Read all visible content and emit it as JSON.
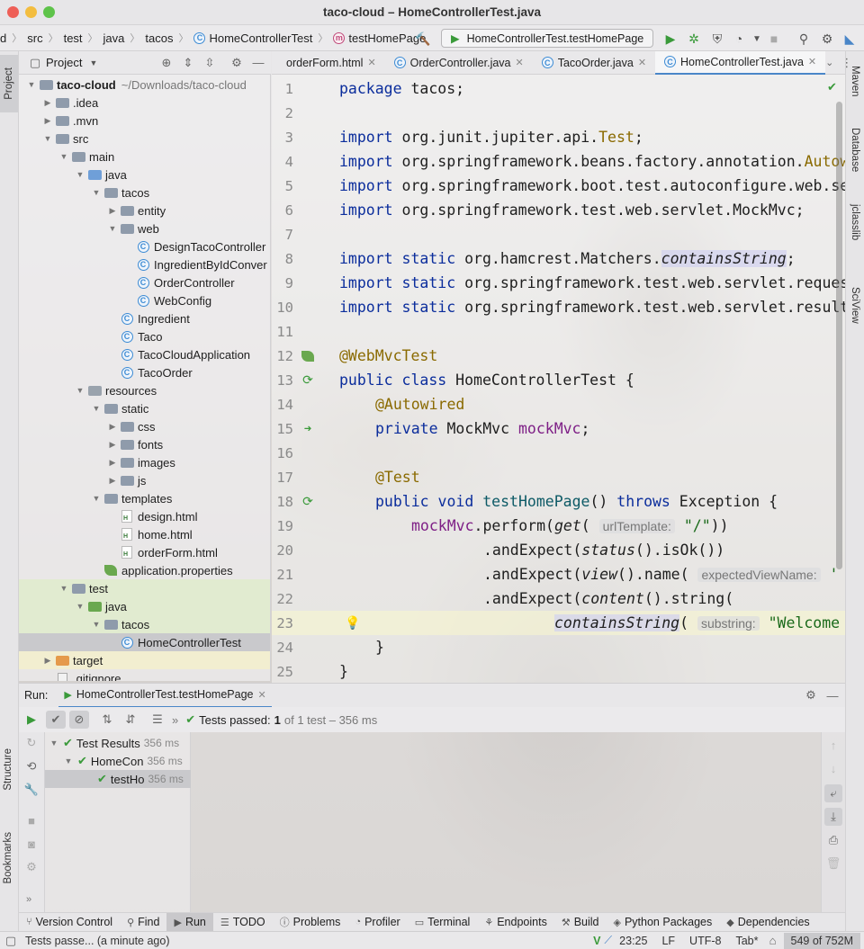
{
  "window": {
    "title": "taco-cloud – HomeControllerTest.java"
  },
  "navbar": {
    "breadcrumbs": [
      "d",
      "src",
      "test",
      "java",
      "tacos",
      "HomeControllerTest",
      "testHomePage"
    ],
    "run_config": "HomeControllerTest.testHomePage"
  },
  "left_stripe": {
    "project_label": "Project",
    "structure_label": "Structure",
    "bookmarks_label": "Bookmarks"
  },
  "right_stripe": {
    "items": [
      "Maven",
      "Database",
      "jclasslib",
      "SciView"
    ]
  },
  "project_panel": {
    "title": "Project",
    "tree": [
      {
        "label": "taco-cloud",
        "extra": "~/Downloads/taco-cloud",
        "depth": 0,
        "arrow": "down",
        "icon": "folder"
      },
      {
        "label": ".idea",
        "depth": 1,
        "arrow": "right",
        "icon": "folder"
      },
      {
        "label": ".mvn",
        "depth": 1,
        "arrow": "right",
        "icon": "folder"
      },
      {
        "label": "src",
        "depth": 1,
        "arrow": "down",
        "icon": "folder"
      },
      {
        "label": "main",
        "depth": 2,
        "arrow": "down",
        "icon": "folder"
      },
      {
        "label": "java",
        "depth": 3,
        "arrow": "down",
        "icon": "src"
      },
      {
        "label": "tacos",
        "depth": 4,
        "arrow": "down",
        "icon": "folder"
      },
      {
        "label": "entity",
        "depth": 5,
        "arrow": "right",
        "icon": "folder"
      },
      {
        "label": "web",
        "depth": 5,
        "arrow": "down",
        "icon": "folder"
      },
      {
        "label": "DesignTacoController",
        "depth": 6,
        "arrow": "",
        "icon": "class"
      },
      {
        "label": "IngredientByIdConver",
        "depth": 6,
        "arrow": "",
        "icon": "class"
      },
      {
        "label": "OrderController",
        "depth": 6,
        "arrow": "",
        "icon": "class"
      },
      {
        "label": "WebConfig",
        "depth": 6,
        "arrow": "",
        "icon": "class"
      },
      {
        "label": "Ingredient",
        "depth": 5,
        "arrow": "",
        "icon": "class"
      },
      {
        "label": "Taco",
        "depth": 5,
        "arrow": "",
        "icon": "class"
      },
      {
        "label": "TacoCloudApplication",
        "depth": 5,
        "arrow": "",
        "icon": "class"
      },
      {
        "label": "TacoOrder",
        "depth": 5,
        "arrow": "",
        "icon": "class"
      },
      {
        "label": "resources",
        "depth": 3,
        "arrow": "down",
        "icon": "res"
      },
      {
        "label": "static",
        "depth": 4,
        "arrow": "down",
        "icon": "folder"
      },
      {
        "label": "css",
        "depth": 5,
        "arrow": "right",
        "icon": "folder"
      },
      {
        "label": "fonts",
        "depth": 5,
        "arrow": "right",
        "icon": "folder"
      },
      {
        "label": "images",
        "depth": 5,
        "arrow": "right",
        "icon": "folder"
      },
      {
        "label": "js",
        "depth": 5,
        "arrow": "right",
        "icon": "folder"
      },
      {
        "label": "templates",
        "depth": 4,
        "arrow": "down",
        "icon": "folder"
      },
      {
        "label": "design.html",
        "depth": 5,
        "arrow": "",
        "icon": "html"
      },
      {
        "label": "home.html",
        "depth": 5,
        "arrow": "",
        "icon": "html"
      },
      {
        "label": "orderForm.html",
        "depth": 5,
        "arrow": "",
        "icon": "html"
      },
      {
        "label": "application.properties",
        "depth": 4,
        "arrow": "",
        "icon": "leaf"
      },
      {
        "label": "test",
        "depth": 2,
        "arrow": "down",
        "icon": "folder"
      },
      {
        "label": "java",
        "depth": 3,
        "arrow": "down",
        "icon": "test"
      },
      {
        "label": "tacos",
        "depth": 4,
        "arrow": "down",
        "icon": "folder"
      },
      {
        "label": "HomeControllerTest",
        "depth": 5,
        "arrow": "",
        "icon": "class"
      },
      {
        "label": "target",
        "depth": 1,
        "arrow": "right",
        "icon": "orange"
      },
      {
        "label": ".gitignore",
        "depth": 1,
        "arrow": "",
        "icon": "file"
      }
    ]
  },
  "editor": {
    "tabs": [
      {
        "label": "orderForm.html",
        "icon": "html",
        "active": false
      },
      {
        "label": "OrderController.java",
        "icon": "class",
        "active": false
      },
      {
        "label": "TacoOrder.java",
        "icon": "class",
        "active": false
      },
      {
        "label": "HomeControllerTest.java",
        "icon": "class",
        "active": true
      }
    ],
    "line_numbers": [
      "1",
      "2",
      "3",
      "4",
      "5",
      "6",
      "7",
      "8",
      "9",
      "10",
      "11",
      "12",
      "13",
      "14",
      "15",
      "16",
      "17",
      "18",
      "19",
      "20",
      "21",
      "22",
      "23",
      "24",
      "25"
    ],
    "code": {
      "l1_kw": "package",
      "l1_rest": " tacos;",
      "imp": "import",
      "imp_static": "static",
      "l3": " org.junit.jupiter.api.",
      "l3_b": "Test",
      "l3_c": ";",
      "l4": " org.springframework.beans.factory.annotation.",
      "l4_b": "Autow",
      "l5": " org.springframework.boot.test.autoconfigure.web.se",
      "l6": " org.springframework.test.web.servlet.MockMvc;",
      "l8": " org.hamcrest.Matchers.",
      "l8_b": "containsString",
      "l8_c": ";",
      "l9": " org.springframework.test.web.servlet.reques",
      "l10": " org.springframework.test.web.servlet.result",
      "l12": "@WebMvcTest",
      "l13_kw1": "public",
      "l13_kw2": "class",
      "l13_rest": " HomeControllerTest {",
      "l14": "@Autowired",
      "l15_kw": "private",
      "l15_type": " MockMvc ",
      "l15_fld": "mockMvc",
      "l15_c": ";",
      "l17": "@Test",
      "l18_kw1": "public",
      "l18_kw2": "void",
      "l18_fn": "testHomePage",
      "l18_p": "() ",
      "l18_kw3": "throws",
      "l18_rest": " Exception {",
      "l19_fld": "mockMvc",
      "l19_a": ".perform(",
      "l19_get": "get",
      "l19_b": "(",
      "l19_hint": "urlTemplate:",
      "l19_str": "\"/\"",
      "l19_c": "))",
      "l20_a": ".andExpect(",
      "l20_fn": "status",
      "l20_b": "().isOk())",
      "l21_a": ".andExpect(",
      "l21_fn": "view",
      "l21_b": "().name(",
      "l21_hint": "expectedViewName:",
      "l21_c": "'",
      "l22_a": ".andExpect(",
      "l22_fn": "content",
      "l22_b": "().string(",
      "l23_fn": "containsString",
      "l23_b": "(",
      "l23_hint": "substring:",
      "l23_str": "\"Welcome",
      "l24": "}",
      "l25": "}"
    }
  },
  "run_panel": {
    "label": "Run:",
    "tab": "HomeControllerTest.testHomePage",
    "status_prefix": "Tests passed:",
    "status_count": "1",
    "status_suffix": "of 1 test – 356 ms",
    "results": [
      {
        "label": "Test Results",
        "time": "356 ms",
        "depth": 0
      },
      {
        "label": "HomeCon",
        "time": "356 ms",
        "depth": 1
      },
      {
        "label": "testHo",
        "time": "356 ms",
        "depth": 2
      }
    ]
  },
  "tool_windows": [
    {
      "label": "Version Control",
      "icon": "branch-icon",
      "active": false
    },
    {
      "label": "Find",
      "icon": "search-icon",
      "active": false
    },
    {
      "label": "Run",
      "icon": "play-icon",
      "active": true
    },
    {
      "label": "TODO",
      "icon": "list-icon",
      "active": false
    },
    {
      "label": "Problems",
      "icon": "info-icon",
      "active": false
    },
    {
      "label": "Profiler",
      "icon": "gauge-icon",
      "active": false
    },
    {
      "label": "Terminal",
      "icon": "terminal-icon",
      "active": false
    },
    {
      "label": "Endpoints",
      "icon": "endpoints-icon",
      "active": false
    },
    {
      "label": "Build",
      "icon": "hammer-icon",
      "active": false
    },
    {
      "label": "Python Packages",
      "icon": "package-icon",
      "active": false
    },
    {
      "label": "Dependencies",
      "icon": "stack-icon",
      "active": false
    }
  ],
  "statusbar": {
    "message": "Tests passe... (a minute ago)",
    "position": "23:25",
    "line_sep": "LF",
    "encoding": "UTF-8",
    "indent": "Tab*",
    "memory": "549 of 752M"
  },
  "colors": {
    "accent": "#4a86c8",
    "success": "#3a9a3a",
    "keyword": "#0b2d9c",
    "annotation": "#8a6a00"
  }
}
